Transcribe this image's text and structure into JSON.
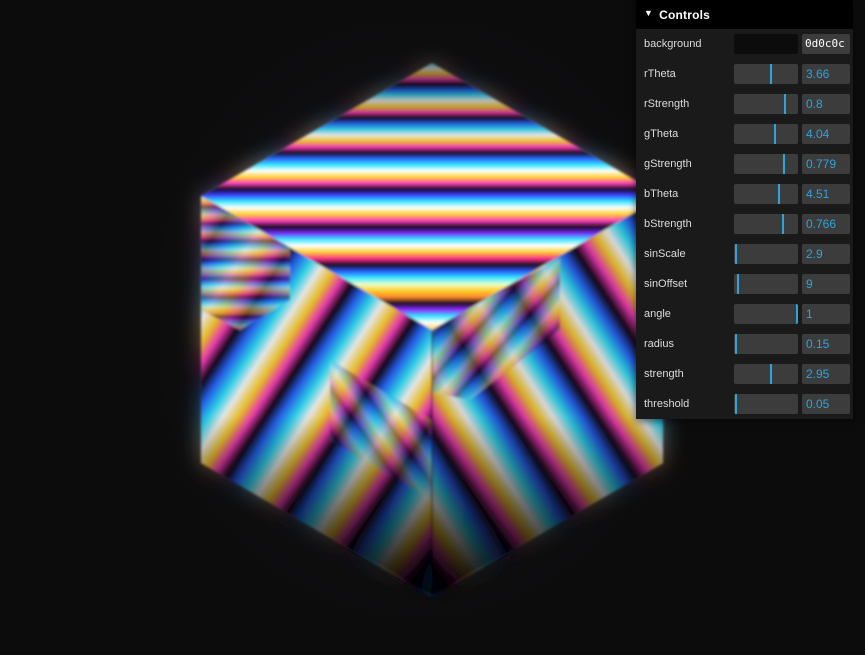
{
  "canvas": {
    "background_color": "#0d0c0c",
    "scene_name": "striped-rainbow-cube"
  },
  "panel": {
    "title": "Controls",
    "collapse_icon": "chevron-down-icon",
    "collapsed": false,
    "accent_color": "#2fa4db",
    "track_color": "#3c3c3c",
    "panel_background": "#1a1a1a",
    "header_background": "#000000"
  },
  "rows": [
    {
      "name": "background",
      "label": "background",
      "type": "color",
      "value": "0d0c0c",
      "swatch_color": "#0d0c0c"
    },
    {
      "name": "rTheta",
      "label": "rTheta",
      "type": "slider",
      "value": "3.66",
      "percent": 58
    },
    {
      "name": "rStrength",
      "label": "rStrength",
      "type": "slider",
      "value": "0.8",
      "percent": 80
    },
    {
      "name": "gTheta",
      "label": "gTheta",
      "type": "slider",
      "value": "4.04",
      "percent": 64
    },
    {
      "name": "gStrength",
      "label": "gStrength",
      "type": "slider",
      "value": "0.779",
      "percent": 78
    },
    {
      "name": "bTheta",
      "label": "bTheta",
      "type": "slider",
      "value": "4.51",
      "percent": 71
    },
    {
      "name": "bStrength",
      "label": "bStrength",
      "type": "slider",
      "value": "0.766",
      "percent": 77
    },
    {
      "name": "sinScale",
      "label": "sinScale",
      "type": "slider",
      "value": "2.9",
      "percent": 3
    },
    {
      "name": "sinOffset",
      "label": "sinOffset",
      "type": "slider",
      "value": "9",
      "percent": 7
    },
    {
      "name": "angle",
      "label": "angle",
      "type": "slider",
      "value": "1",
      "percent": 98
    },
    {
      "name": "radius",
      "label": "radius",
      "type": "slider",
      "value": "0.15",
      "percent": 3
    },
    {
      "name": "strength",
      "label": "strength",
      "type": "slider",
      "value": "2.95",
      "percent": 58
    },
    {
      "name": "threshold",
      "label": "threshold",
      "type": "slider",
      "value": "0.05",
      "percent": 3
    }
  ]
}
